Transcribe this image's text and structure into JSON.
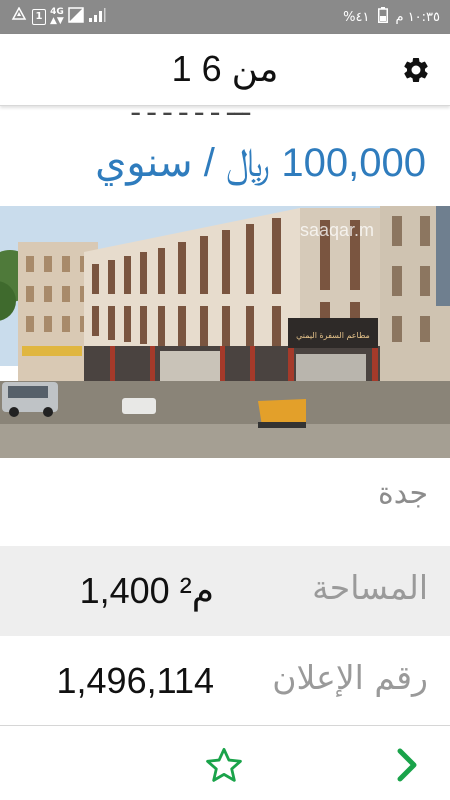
{
  "status_bar": {
    "time": "١٠:٣٥ م",
    "battery": "%٤١",
    "network": "4G",
    "sim_slot": "1",
    "icons": [
      "signal-icon",
      "battery-icon",
      "data-usage-icon",
      "sim-icon",
      "recycle-icon"
    ]
  },
  "header": {
    "pager": "1 من 6",
    "settings_icon": "gear-icon"
  },
  "listing": {
    "cut_title": "ـــ ـ ـ ـ ـ ـ ـ",
    "price": "100,000",
    "price_currency": "﷼",
    "price_period": "/ سنوي",
    "photo_alt": "عمارة تجارية - جدة",
    "photo_watermark": "saaqar.m",
    "shop_sign": "مطاعم السفرة اليمني",
    "city": "جدة"
  },
  "details": {
    "area_label": "المساحة",
    "area_value": "1,400",
    "area_unit": "م²",
    "ad_number_label": "رقم الإعلان",
    "ad_number_value": "1,496,114"
  },
  "actions": {
    "favorite_icon": "star-outline-icon",
    "next_icon": "chevron-right-icon"
  },
  "colors": {
    "accent_blue": "#2f7cbd",
    "icon_green": "#1aa34a",
    "status_bar": "#8a8a8a"
  }
}
